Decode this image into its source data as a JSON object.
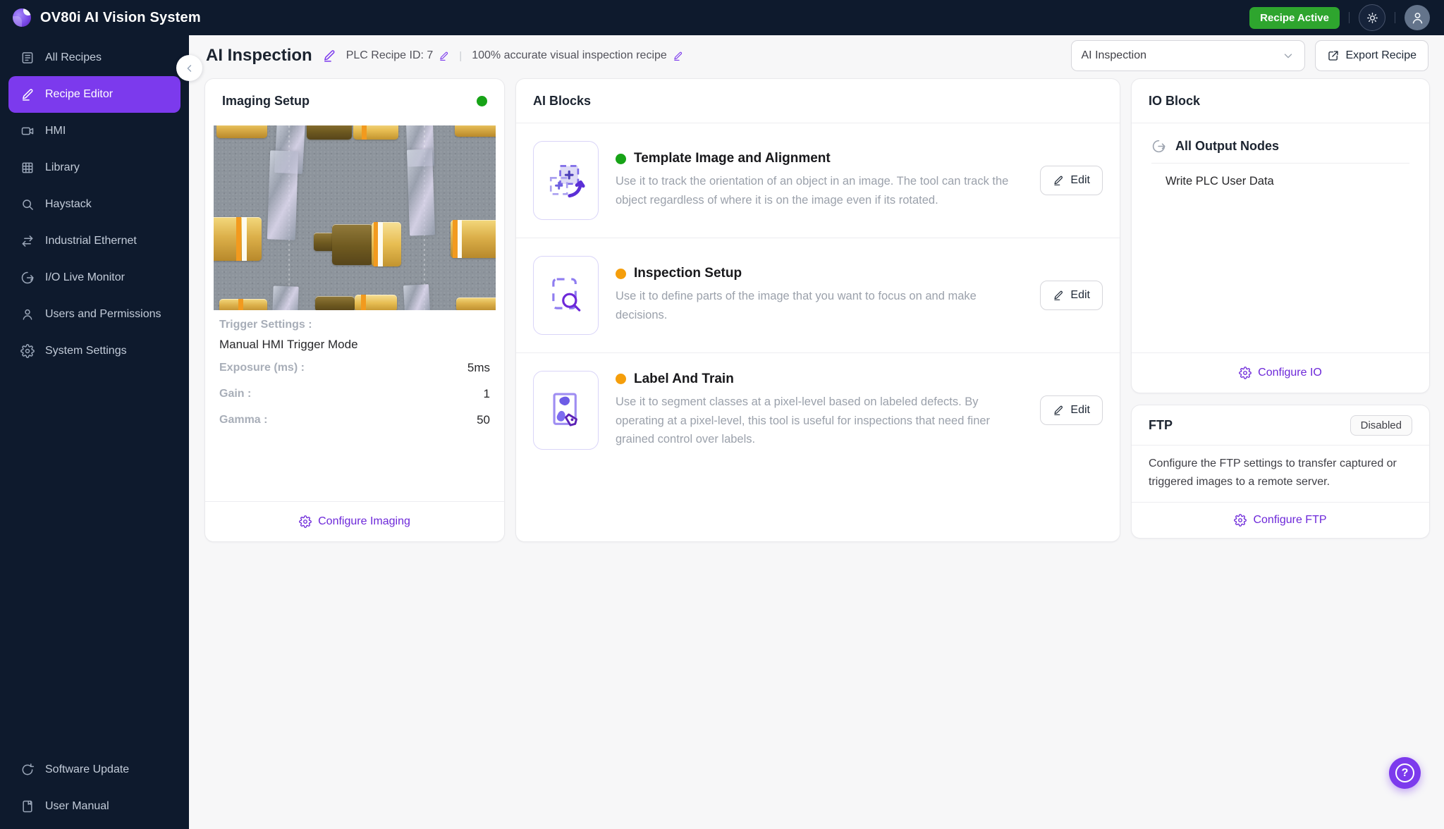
{
  "topbar": {
    "app_title": "OV80i AI Vision System",
    "recipe_status_badge": "Recipe Active"
  },
  "sidebar": {
    "items": [
      {
        "label": "All Recipes",
        "icon": "recipes-list-icon",
        "active": false
      },
      {
        "label": "Recipe Editor",
        "icon": "pencil-icon",
        "active": true
      },
      {
        "label": "HMI",
        "icon": "hmi-camera-icon",
        "active": false
      },
      {
        "label": "Library",
        "icon": "grid-icon",
        "active": false
      },
      {
        "label": "Haystack",
        "icon": "search-icon",
        "active": false
      },
      {
        "label": "Industrial Ethernet",
        "icon": "swap-arrows-icon",
        "active": false
      },
      {
        "label": "I/O Live Monitor",
        "icon": "circular-arrow-icon",
        "active": false
      },
      {
        "label": "Users and Permissions",
        "icon": "user-icon",
        "active": false
      },
      {
        "label": "System Settings",
        "icon": "gear-icon",
        "active": false
      }
    ],
    "bottom_items": [
      {
        "label": "Software Update",
        "icon": "refresh-icon"
      },
      {
        "label": "User Manual",
        "icon": "manual-book-icon"
      }
    ]
  },
  "header": {
    "recipe_title": "AI Inspection",
    "plc_recipe_id": "PLC Recipe ID: 7",
    "separator": "|",
    "recipe_description": "100% accurate visual inspection recipe",
    "recipe_select_value": "AI Inspection",
    "export_button": "Export Recipe"
  },
  "imaging_setup": {
    "card_title": "Imaging Setup",
    "status": "ready",
    "trigger_settings_label": "Trigger Settings :",
    "trigger_mode": "Manual HMI Trigger Mode",
    "params": [
      {
        "label": "Exposure (ms) :",
        "value": "5ms"
      },
      {
        "label": "Gain :",
        "value": "1"
      },
      {
        "label": "Gamma :",
        "value": "50"
      }
    ],
    "configure_link": "Configure Imaging"
  },
  "ai_blocks": {
    "card_title": "AI Blocks",
    "edit_button": "Edit",
    "blocks": [
      {
        "title": "Template Image and Alignment",
        "status": "ready",
        "status_color": "#17a317",
        "description": "Use it to track the orientation of an object in an image. The tool can track the object regardless of where it is on the image even if its rotated."
      },
      {
        "title": "Inspection Setup",
        "status": "pending",
        "status_color": "#f59e0b",
        "description": "Use it to define parts of the image that you want to focus on and make decisions."
      },
      {
        "title": "Label And Train",
        "status": "pending",
        "status_color": "#f59e0b",
        "description": "Use it to segment classes at a pixel-level based on labeled defects. By operating at a pixel-level, this tool is useful for inspections that need finer grained control over labels."
      }
    ]
  },
  "io_block": {
    "card_title": "IO Block",
    "group_title": "All Output Nodes",
    "nodes": [
      "Write PLC User Data"
    ],
    "configure_link": "Configure IO"
  },
  "ftp": {
    "card_title": "FTP",
    "status_badge": "Disabled",
    "description": "Configure the FTP settings to transfer captured or triggered images to a remote server.",
    "configure_link": "Configure FTP"
  },
  "colors": {
    "topbar_navy": "#0e1a2d",
    "accent_purple": "#7c3aed",
    "link_purple": "#6d28d9",
    "active_badge_green": "#2ea52e",
    "status_green": "#17a317",
    "status_orange": "#f59e0b",
    "page_bg": "#f7f7f8"
  }
}
